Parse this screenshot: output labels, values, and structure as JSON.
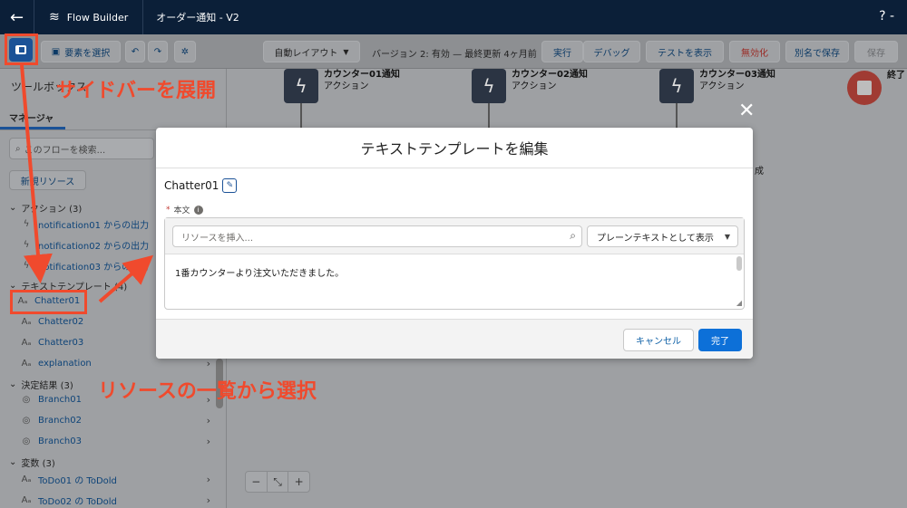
{
  "topbar": {
    "app_name": "Flow Builder",
    "flow_name": "オーダー通知 - V2",
    "help": "? -"
  },
  "toolbar": {
    "add_element": "要素を選択",
    "auto_layout": "自動レイアウト",
    "version_status": "バージョン 2: 有効 — 最終更新 4ヶ月前",
    "run": "実行",
    "debug": "デバッグ",
    "view_tests": "テストを表示",
    "deactivate": "無効化",
    "save_as": "別名で保存",
    "save": "保存"
  },
  "sidebar": {
    "title": "ツールボックス",
    "tab": "マネージャ",
    "search_placeholder": "このフローを検索...",
    "new_resource": "新規リソース",
    "groups": [
      {
        "label": "アクション (3)",
        "items": [
          "notification01 からの出力",
          "notification02 からの出力",
          "notification03 からの出力"
        ]
      },
      {
        "label": "テキストテンプレート (4)",
        "items": [
          "Chatter01",
          "Chatter02",
          "Chatter03",
          "explanation"
        ]
      },
      {
        "label": "決定結果 (3)",
        "items": [
          "Branch01",
          "Branch02",
          "Branch03"
        ]
      },
      {
        "label": "変数 (3)",
        "items": [
          "ToDo01 の ToDold",
          "ToDo02 の ToDold"
        ]
      }
    ]
  },
  "canvas": {
    "nodes": [
      {
        "title": "カウンター01通知",
        "type": "アクション"
      },
      {
        "title": "カウンター02通知",
        "type": "アクション"
      },
      {
        "title": "カウンター03通知",
        "type": "アクション"
      }
    ],
    "end_label": "終了",
    "partial_label": "成"
  },
  "modal": {
    "title": "テキストテンプレートを編集",
    "name": "Chatter01",
    "field_label": "本文",
    "resource_placeholder": "リソースを挿入...",
    "view_mode": "プレーンテキストとして表示",
    "body": "1番カウンターより注文いただきました。",
    "cancel": "キャンセル",
    "done": "完了"
  },
  "annotations": {
    "sidebar": "サイドバーを展開",
    "select": "リソースの一覧から選択"
  },
  "colors": {
    "annotation": "#f04a2d",
    "brand": "#1b5297",
    "primary": "#0d70d8"
  }
}
